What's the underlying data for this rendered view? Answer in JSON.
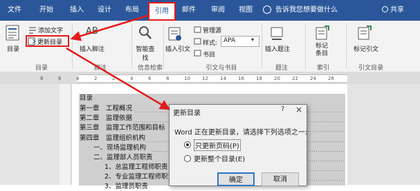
{
  "tabs": [
    {
      "label": "文件"
    },
    {
      "label": "开始"
    },
    {
      "label": "插入"
    },
    {
      "label": "设计"
    },
    {
      "label": "布局"
    },
    {
      "label": "引用"
    },
    {
      "label": "邮件"
    },
    {
      "label": "审阅"
    },
    {
      "label": "视图"
    }
  ],
  "tell_me": "告诉我您想要做什么",
  "share": "共享",
  "ribbon": {
    "toc": {
      "label": "目录",
      "add_text": "添加文字",
      "update": "更新目录",
      "group": "目录"
    },
    "footnotes": {
      "insert": "插入脚注",
      "ab": "AB",
      "group": "脚注"
    },
    "research": {
      "search": "智能查找",
      "group": "信息检索"
    },
    "citations": {
      "insert": "插入引文",
      "manage": "管理源",
      "style_label": "样式:",
      "style_value": "APA",
      "biblio": "书目",
      "group": "引文与书目"
    },
    "captions": {
      "insert": "插入题注",
      "group": "题注"
    },
    "index": {
      "mark": "标记条目",
      "group": "索引"
    },
    "authorities": {
      "mark": "标记引文",
      "group": "引文目录"
    }
  },
  "ruler_numbers": [
    "8",
    "6",
    "4",
    "2",
    "2",
    "4",
    "6",
    "8",
    "10",
    "12",
    "14",
    "16",
    "18",
    "20",
    "22",
    "24",
    "26"
  ],
  "document": {
    "lines": [
      {
        "text": "目录"
      },
      {
        "text": "第一章　工程概况"
      },
      {
        "text": "第二章　监理依据"
      },
      {
        "text": "第三章　监理工作范围和目标"
      },
      {
        "text": "第四章　监理组织机构"
      },
      {
        "text": "一、现场监理机构"
      },
      {
        "text": "二、监理部人员职责"
      },
      {
        "text": "1、总监理工程师职责"
      },
      {
        "text": "2、专业监理工程师职责"
      },
      {
        "text": "3、监理员职责"
      }
    ]
  },
  "dialog": {
    "title": "更新目录",
    "help": "?",
    "close": "×",
    "message": "Word 正在更新目录，请选择下列选项之一:",
    "option1": "只更新页码(P)",
    "option2": "更新整个目录(E)",
    "ok": "确定",
    "cancel": "取消",
    "selected_option": 1
  },
  "colors": {
    "titlebar": "#2b579a",
    "highlight": "#e21b1b",
    "toc_shade": "#cfcfcf"
  }
}
